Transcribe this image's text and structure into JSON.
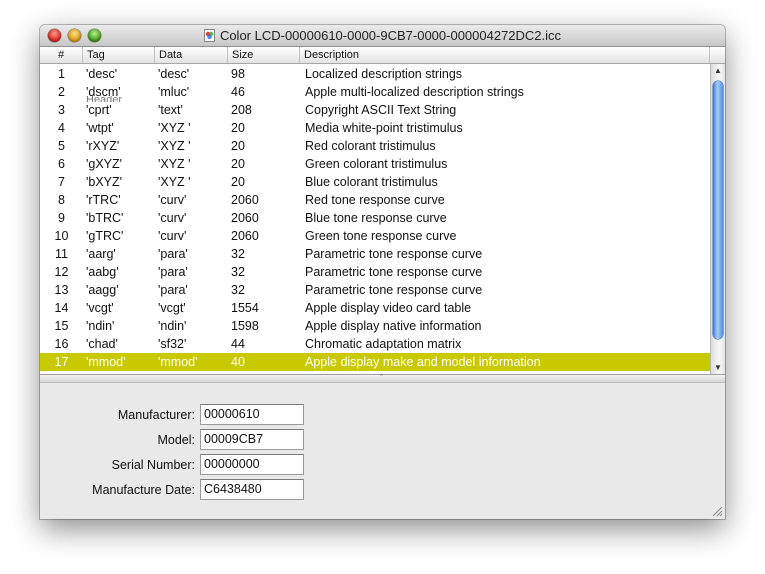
{
  "window": {
    "title": "Color LCD-00000610-0000-9CB7-0000-000004272DC2.icc"
  },
  "table": {
    "columns": [
      "#",
      "Tag",
      "Data",
      "Size",
      "Description"
    ],
    "ghost_row": "Header",
    "rows": [
      {
        "num": "1",
        "tag": "'desc'",
        "data": "'desc'",
        "size": "98",
        "desc": "Localized description strings"
      },
      {
        "num": "2",
        "tag": "'dscm'",
        "data": "'mluc'",
        "size": "46",
        "desc": "Apple multi-localized description strings"
      },
      {
        "num": "3",
        "tag": "'cprt'",
        "data": "'text'",
        "size": "208",
        "desc": "Copyright ASCII Text String"
      },
      {
        "num": "4",
        "tag": "'wtpt'",
        "data": "'XYZ '",
        "size": "20",
        "desc": "Media white-point tristimulus"
      },
      {
        "num": "5",
        "tag": "'rXYZ'",
        "data": "'XYZ '",
        "size": "20",
        "desc": "Red colorant tristimulus"
      },
      {
        "num": "6",
        "tag": "'gXYZ'",
        "data": "'XYZ '",
        "size": "20",
        "desc": "Green colorant tristimulus"
      },
      {
        "num": "7",
        "tag": "'bXYZ'",
        "data": "'XYZ '",
        "size": "20",
        "desc": "Blue colorant tristimulus"
      },
      {
        "num": "8",
        "tag": "'rTRC'",
        "data": "'curv'",
        "size": "2060",
        "desc": "Red tone response curve"
      },
      {
        "num": "9",
        "tag": "'bTRC'",
        "data": "'curv'",
        "size": "2060",
        "desc": "Blue tone response curve"
      },
      {
        "num": "10",
        "tag": "'gTRC'",
        "data": "'curv'",
        "size": "2060",
        "desc": "Green tone response curve"
      },
      {
        "num": "11",
        "tag": "'aarg'",
        "data": "'para'",
        "size": "32",
        "desc": "Parametric tone response curve"
      },
      {
        "num": "12",
        "tag": "'aabg'",
        "data": "'para'",
        "size": "32",
        "desc": "Parametric tone response curve"
      },
      {
        "num": "13",
        "tag": "'aagg'",
        "data": "'para'",
        "size": "32",
        "desc": "Parametric tone response curve"
      },
      {
        "num": "14",
        "tag": "'vcgt'",
        "data": "'vcgt'",
        "size": "1554",
        "desc": "Apple display video card table"
      },
      {
        "num": "15",
        "tag": "'ndin'",
        "data": "'ndin'",
        "size": "1598",
        "desc": "Apple display native information"
      },
      {
        "num": "16",
        "tag": "'chad'",
        "data": "'sf32'",
        "size": "44",
        "desc": "Chromatic adaptation matrix"
      },
      {
        "num": "17",
        "tag": "'mmod'",
        "data": "'mmod'",
        "size": "40",
        "desc": "Apple display make and model information",
        "selected": true
      }
    ]
  },
  "details": {
    "fields": [
      {
        "label": "Manufacturer:",
        "value": "00000610"
      },
      {
        "label": "Model:",
        "value": "00009CB7"
      },
      {
        "label": "Serial Number:",
        "value": "00000000"
      },
      {
        "label": "Manufacture Date:",
        "value": "C6438480"
      }
    ]
  },
  "colors": {
    "selection": "#c9c900",
    "scroll_thumb": "#3a78d8"
  },
  "icons": {
    "close": "close-icon",
    "minimize": "minimize-icon",
    "zoom": "zoom-icon",
    "document": "icc-document-icon",
    "scroll_up": "scroll-up-arrow-icon",
    "scroll_down": "scroll-down-arrow-icon",
    "resize": "resize-grip-icon"
  }
}
